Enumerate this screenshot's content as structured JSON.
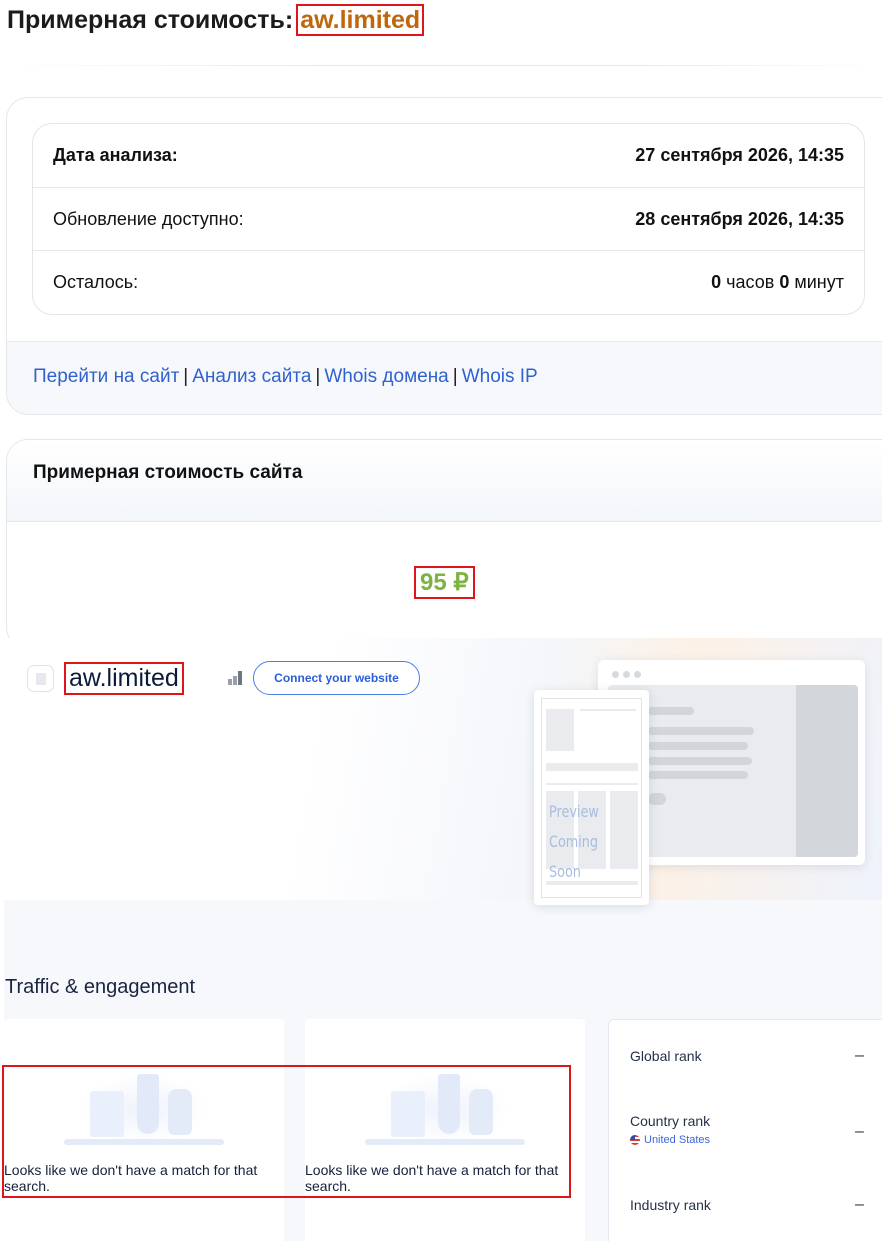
{
  "heading": {
    "prefix": "Примерная стоимость:",
    "domain": "aw.limited"
  },
  "info": {
    "rows": [
      {
        "label": "Дата анализа:",
        "value": "27 сентября 2026, 14:35"
      },
      {
        "label": "Обновление доступно:",
        "value": "28 сентября 2026, 14:35"
      },
      {
        "label": "Осталось:",
        "hours": "0",
        "hours_unit": "часов",
        "minutes": "0",
        "minutes_unit": "минут"
      }
    ]
  },
  "links": {
    "go_to_site": "Перейти на сайт",
    "site_analysis": "Анализ сайта",
    "whois_domain": "Whois домена",
    "whois_ip": "Whois IP",
    "separator": "|"
  },
  "valuation": {
    "title": "Примерная стоимость сайта",
    "price": "95 ₽",
    "price_color": "#7cb342"
  },
  "embed": {
    "site_name": "aw.limited",
    "connect_label": "Connect your website",
    "preview_text": "Preview Coming Soon",
    "section_title": "Traffic & engagement",
    "no_match_text": "Looks like we don't have a match for that search.",
    "ranks": {
      "global_label": "Global rank",
      "global_value": "–",
      "country_label": "Country rank",
      "country_name": "United States",
      "country_value": "–",
      "industry_label": "Industry rank",
      "industry_value": "–"
    }
  },
  "colors": {
    "link": "#2f62cf",
    "domain_highlight": "#c0670d",
    "annotation_box": "#e0141b",
    "connect_button": "#2b5fd9"
  }
}
